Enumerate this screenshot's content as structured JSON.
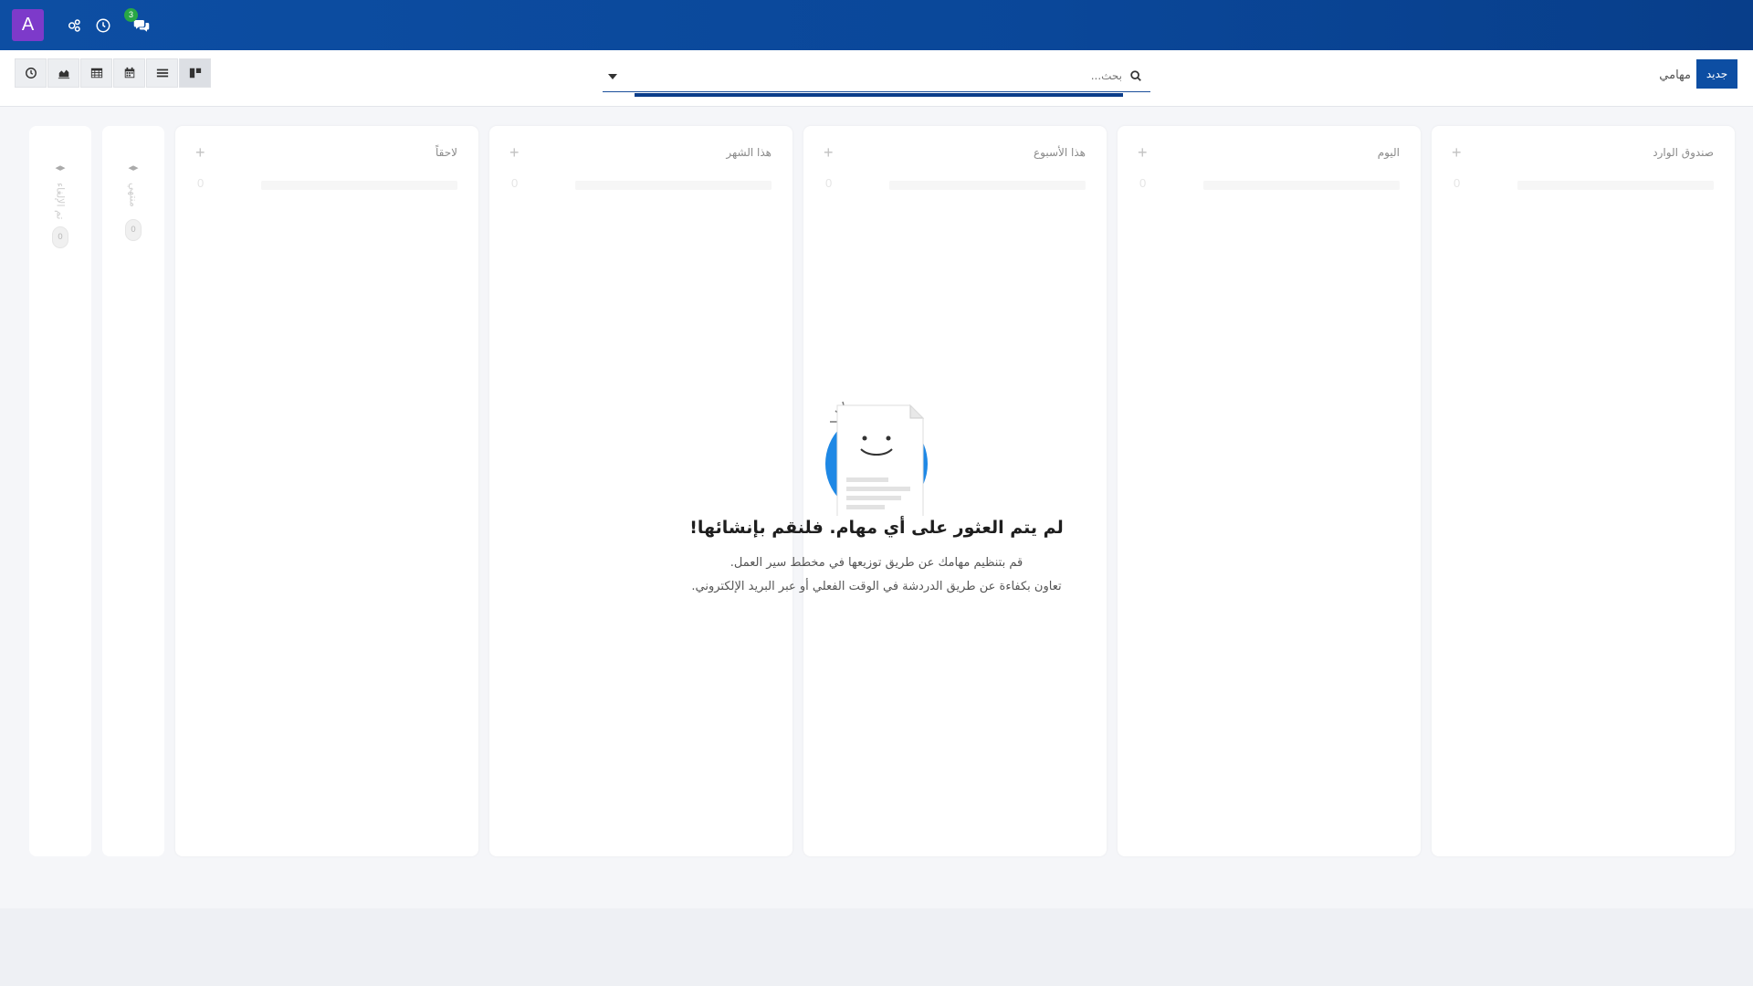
{
  "navbar": {
    "avatar_letter": "A",
    "messages_badge": "3"
  },
  "control_panel": {
    "new_button": "جديد",
    "breadcrumb": "مهامي",
    "search": {
      "placeholder": "بحث..."
    }
  },
  "columns": [
    {
      "title": "صندوق الوارد",
      "count": "0"
    },
    {
      "title": "اليوم",
      "count": "0"
    },
    {
      "title": "هذا الأسبوع",
      "count": "0"
    },
    {
      "title": "هذا الشهر",
      "count": "0"
    },
    {
      "title": "لاحقاً",
      "count": "0"
    }
  ],
  "folded_columns": [
    {
      "title": "منتهي",
      "count": "0"
    },
    {
      "title": "تم الإلغاء",
      "count": "0"
    }
  ],
  "empty_state": {
    "title": "لم يتم العثور على أي مهام. فلنقم بإنشائها!",
    "line1": "قم بتنظيم مهامك عن طريق توزيعها في مخطط سير العمل.",
    "line2": "تعاون بكفاءة عن طريق الدردشة في الوقت الفعلي أو عبر البريد الإلكتروني."
  },
  "colors": {
    "navbar": "#0d4ea3",
    "avatar": "#7d3aca",
    "badge": "#28a745"
  }
}
